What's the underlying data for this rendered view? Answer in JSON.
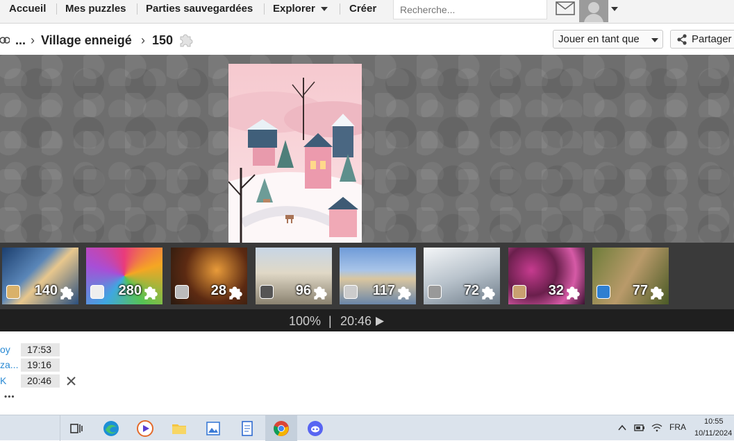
{
  "nav": {
    "home": "Accueil",
    "my_puzzles": "Mes puzzles",
    "saved_games": "Parties sauvegardées",
    "explore": "Explorer",
    "create": "Créer",
    "search_placeholder": "Recherche..."
  },
  "breadcrumb": {
    "ellipsis": "...",
    "title": "Village enneigé",
    "pieces": "150"
  },
  "actions": {
    "play_as": "Jouer en tant que",
    "share": "Partager"
  },
  "thumbnails": [
    {
      "count": "140"
    },
    {
      "count": "280"
    },
    {
      "count": "28"
    },
    {
      "count": "96"
    },
    {
      "count": "117"
    },
    {
      "count": "72"
    },
    {
      "count": "32"
    },
    {
      "count": "77"
    }
  ],
  "status": {
    "progress": "100%",
    "separator": "|",
    "time": "20:46"
  },
  "scores": [
    {
      "name": "oy",
      "time": "17:53"
    },
    {
      "name": "za...",
      "time": "19:16"
    },
    {
      "name": "K",
      "time": "20:46"
    }
  ],
  "more": "•••",
  "taskbar": {
    "lang": "FRA",
    "clock_time": "10:55",
    "clock_date": "10/11/2024"
  }
}
